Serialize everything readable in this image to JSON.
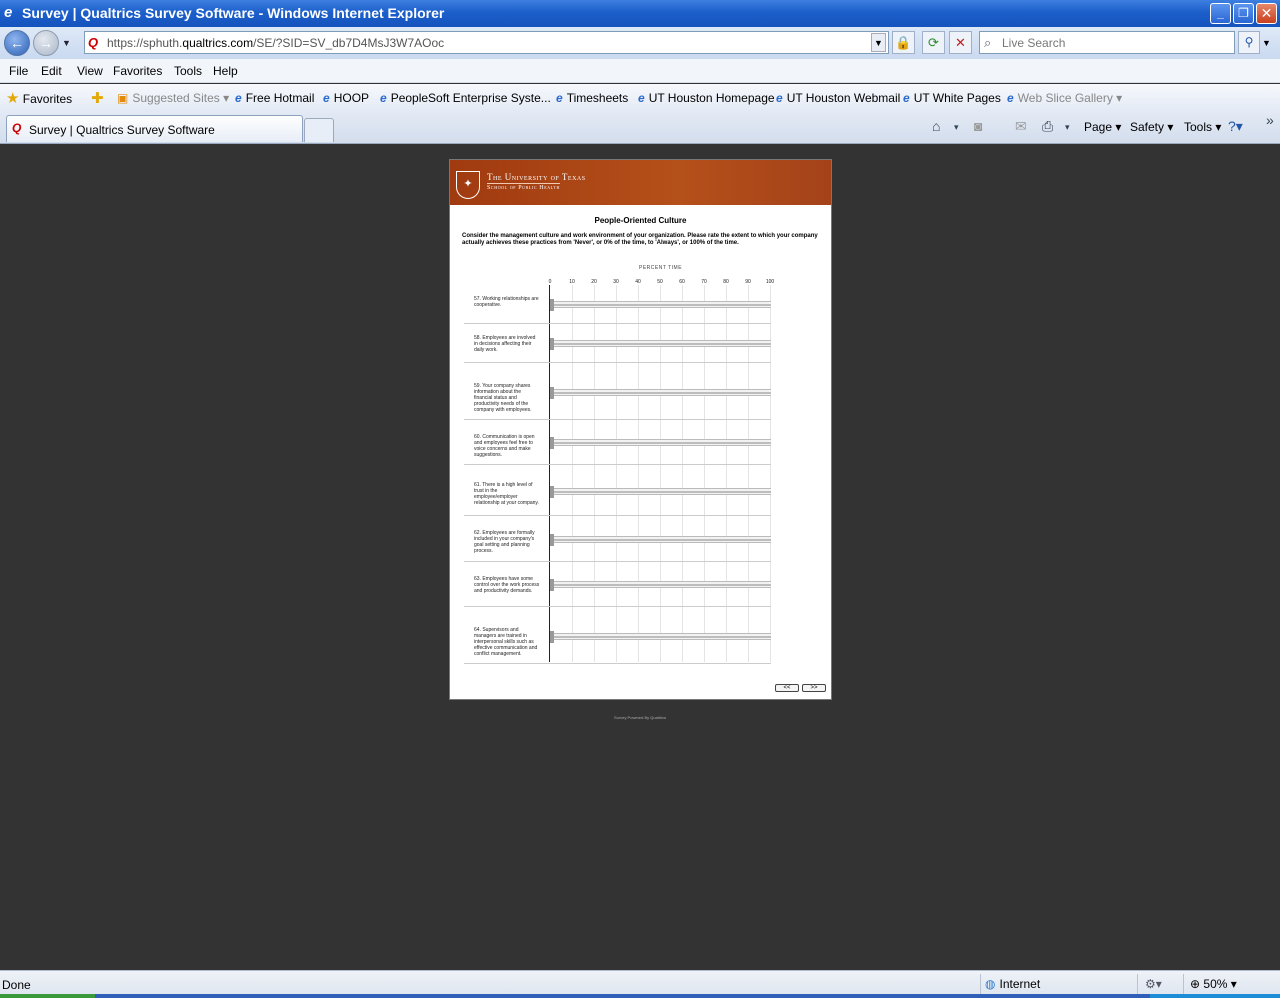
{
  "window": {
    "title": "Survey | Qualtrics Survey Software - Windows Internet Explorer",
    "min_label": "_",
    "max_label": "❐",
    "close_label": "✕"
  },
  "address_bar": {
    "url_prefix": "https://sphuth.",
    "url_domain": "qualtrics.com",
    "url_path": "/SE/?SID=SV_db7D4MsJ3W7AOoc",
    "search_placeholder": "Live Search"
  },
  "menu": [
    "File",
    "Edit",
    "View",
    "Favorites",
    "Tools",
    "Help"
  ],
  "favorites_bar": {
    "favorites_label": "Favorites",
    "items": [
      {
        "label": "Suggested Sites ▾",
        "dim": true
      },
      {
        "label": "Free Hotmail"
      },
      {
        "label": "HOOP"
      },
      {
        "label": "PeopleSoft Enterprise Syste..."
      },
      {
        "label": "Timesheets"
      },
      {
        "label": "UT Houston Homepage"
      },
      {
        "label": "UT Houston Webmail"
      },
      {
        "label": "UT White Pages"
      },
      {
        "label": "Web Slice Gallery ▾",
        "dim": true
      }
    ]
  },
  "tab": {
    "label": "Survey | Qualtrics Survey Software"
  },
  "command_bar": {
    "page": "Page ▾",
    "safety": "Safety ▾",
    "tools": "Tools ▾"
  },
  "survey": {
    "banner_university": "The University of Texas",
    "banner_school": "School of Public Health",
    "title": "People-Oriented Culture",
    "intro": "Consider the management culture and work environment of your organization. Please rate the extent to which your company actually achieves these practices from 'Never', or 0% of the time, to 'Always', or 100% of the time.",
    "scale_label": "PERCENT TIME",
    "ticks": [
      "0",
      "10",
      "20",
      "30",
      "40",
      "50",
      "60",
      "70",
      "80",
      "90",
      "100"
    ],
    "questions": [
      {
        "text": "57. Working relationships are cooperative.",
        "value": 0
      },
      {
        "text": "58. Employees are involved in decisions affecting their daily work.",
        "value": 0
      },
      {
        "text": "59. Your company shares information about the financial status and productivity needs of the company with employees.",
        "value": 0
      },
      {
        "text": "60. Communication is open and employees feel free to voice concerns and make suggestions.",
        "value": 0
      },
      {
        "text": "61. There is a high level of trust in the employee/employer relationship at your company.",
        "value": 0
      },
      {
        "text": "62. Employees are formally included in your company's goal setting and planning process.",
        "value": 0
      },
      {
        "text": "63. Employees have some control over the work process and productivity demands.",
        "value": 0
      },
      {
        "text": "64. Supervisors and managers are trained in interpersonal skills such as effective communication and conflict management.",
        "value": 0
      }
    ],
    "prev_label": "<<",
    "next_label": ">>",
    "footer": "Survey Powered By Qualtrics"
  },
  "status_bar": {
    "status": "Done",
    "zone": "Internet",
    "zoom": "50%"
  }
}
